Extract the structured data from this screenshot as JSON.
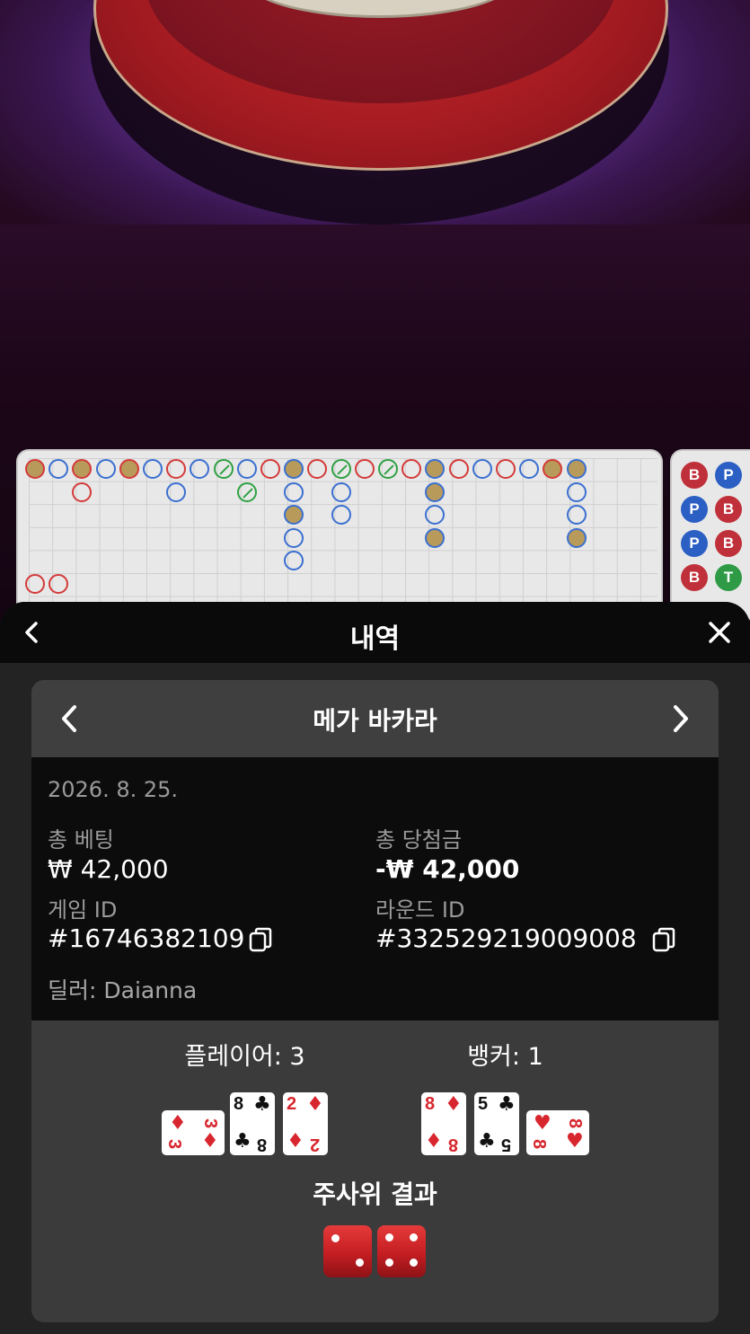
{
  "header": {
    "title": "내역",
    "back_icon": "chevron-left-icon",
    "close_icon": "close-icon"
  },
  "game_bar": {
    "name": "메가 바카라",
    "prev_icon": "chevron-left-icon",
    "next_icon": "chevron-right-icon"
  },
  "details": {
    "date": "2026. 8. 25.",
    "total_bet_label": "총 베팅",
    "total_bet_value": "₩ 42,000",
    "total_win_label": "총 당첨금",
    "total_win_value": "-₩ 42,000",
    "game_id_label": "게임 ID",
    "game_id_value": "#16746382109",
    "round_id_label": "라운드 ID",
    "round_id_value": "#332529219009008",
    "dealer": "딜러: Daianna"
  },
  "result": {
    "player_label": "플레이어: 3",
    "banker_label": "뱅커: 1",
    "player_cards": [
      {
        "rank": "3",
        "suit": "♦",
        "color": "red"
      },
      {
        "rank": "8",
        "suit": "♣",
        "color": "black"
      },
      {
        "rank": "2",
        "suit": "♦",
        "color": "red"
      }
    ],
    "banker_cards": [
      {
        "rank": "8",
        "suit": "♦",
        "color": "red"
      },
      {
        "rank": "5",
        "suit": "♣",
        "color": "black"
      },
      {
        "rank": "8",
        "suit": "♥",
        "color": "red"
      }
    ],
    "dice_title": "주사위 결과",
    "dice": [
      2,
      4
    ]
  },
  "side_board": {
    "chips": [
      "B",
      "P",
      "P",
      "B",
      "P",
      "B",
      "B",
      "T"
    ]
  },
  "colors": {
    "banker": "#d43a3a",
    "player": "#3a6fd0",
    "tie": "#2fa043",
    "sheet_bg": "#232323"
  }
}
